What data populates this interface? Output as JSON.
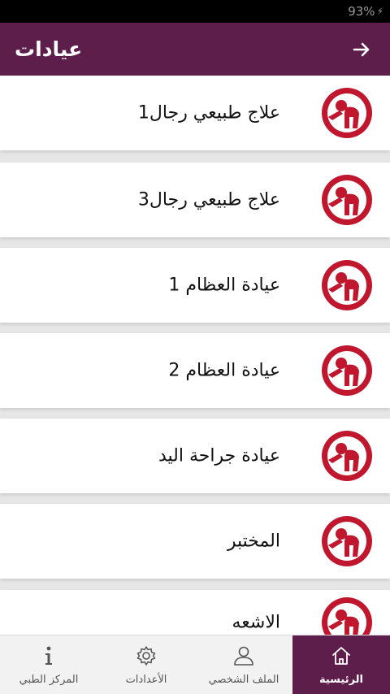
{
  "status_bar": {
    "battery_text": "93%"
  },
  "app_bar": {
    "title": "عيادات"
  },
  "clinics": [
    {
      "name": "علاج طبيعي رجال1"
    },
    {
      "name": "علاج طبيعي رجال3"
    },
    {
      "name": "عيادة العظام 1"
    },
    {
      "name": "عيادة العظام 2"
    },
    {
      "name": "عيادة جراحة اليد"
    },
    {
      "name": "المختبر"
    },
    {
      "name": "الاشعه"
    }
  ],
  "bottom_nav": {
    "items": [
      {
        "label": "الرئيسية",
        "icon": "home-icon",
        "active": true
      },
      {
        "label": "الملف الشخصي",
        "icon": "user-icon",
        "active": false
      },
      {
        "label": "الأعدادات",
        "icon": "gear-icon",
        "active": false
      },
      {
        "label": "المركز الطبي",
        "icon": "info-icon",
        "active": false
      }
    ]
  },
  "colors": {
    "primary": "#5e1e4b",
    "logo_red": "#c0172e"
  }
}
